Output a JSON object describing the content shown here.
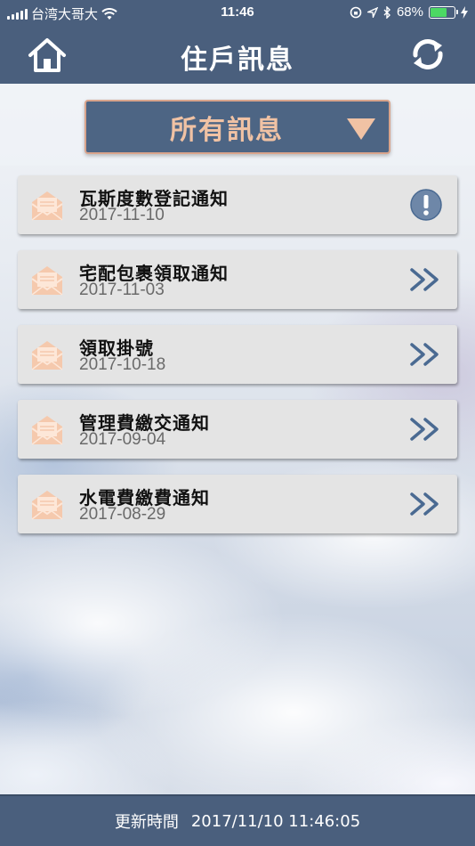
{
  "status_bar": {
    "carrier": "台湾大哥大",
    "time": "11:46",
    "battery": "68%",
    "battery_level": 0.68
  },
  "header": {
    "title": "住戶訊息",
    "home_icon": "home-icon",
    "refresh_icon": "refresh-icon"
  },
  "filter": {
    "selected": "所有訊息"
  },
  "messages": [
    {
      "title": "瓦斯度數登記通知",
      "date": "2017-11-10",
      "action_icon": "alert-icon"
    },
    {
      "title": "宅配包裹領取通知",
      "date": "2017-11-03",
      "action_icon": "chevron-double-right-icon"
    },
    {
      "title": "領取掛號",
      "date": "2017-10-18",
      "action_icon": "chevron-double-right-icon"
    },
    {
      "title": "管理費繳交通知",
      "date": "2017-09-04",
      "action_icon": "chevron-double-right-icon"
    },
    {
      "title": "水電費繳費通知",
      "date": "2017-08-29",
      "action_icon": "chevron-double-right-icon"
    }
  ],
  "footer": {
    "label": "更新時間",
    "timestamp": "2017/11/10 11:46:05"
  },
  "colors": {
    "bar": "#4a5f7d",
    "accent": "#f0c2a4",
    "item_bg": "#e4e4e4",
    "icon_blue": "#4a6a92",
    "envelope": "#f5c9ad"
  }
}
